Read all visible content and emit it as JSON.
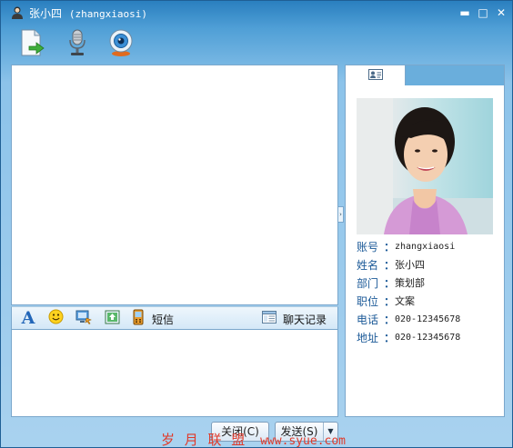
{
  "window": {
    "title_name": "张小四",
    "title_account": "(zhangxiaosi)",
    "minimize_glyph": "▬",
    "maximize_glyph": "□",
    "close_glyph": "✕"
  },
  "toolbar": {
    "items": [
      {
        "name": "send-file",
        "icon": "file-send-icon"
      },
      {
        "name": "voice-chat",
        "icon": "microphone-icon"
      },
      {
        "name": "video-chat",
        "icon": "webcam-icon"
      }
    ]
  },
  "chat_toolbar": {
    "font_glyph": "A",
    "sms_label": "短信",
    "history_label": "聊天记录"
  },
  "buttons": {
    "close_label": "关闭(C)",
    "send_label": "发送(S)",
    "send_arrow": "▼"
  },
  "splitter_glyph": "›",
  "profile": {
    "rows": [
      {
        "label": "账号",
        "value": "zhangxiaosi"
      },
      {
        "label": "姓名",
        "value": "张小四"
      },
      {
        "label": "部门",
        "value": "策划部"
      },
      {
        "label": "职位",
        "value": "文案"
      },
      {
        "label": "电话",
        "value": "020-12345678"
      },
      {
        "label": "地址",
        "value": "020-12345678"
      }
    ],
    "colon": "："
  },
  "watermark": {
    "text": "岁 月 联 盟",
    "url": "www.syue.com"
  },
  "colors": {
    "title_gradient_top": "#2a7fbf",
    "label_blue": "#1c5a98",
    "watermark_red": "#e03a2a"
  }
}
